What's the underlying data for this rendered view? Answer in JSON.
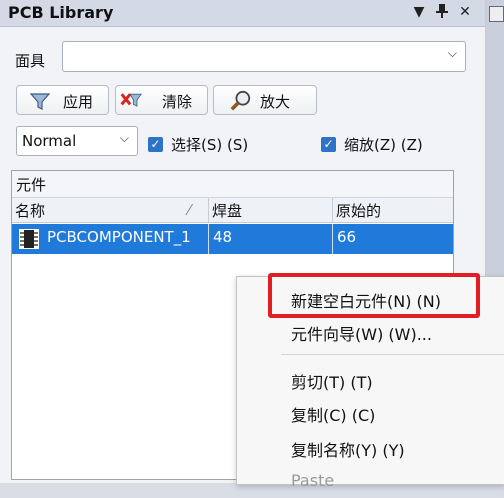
{
  "panel": {
    "title": "PCB Library",
    "title_buttons": [
      "▼",
      "📌",
      "✕"
    ]
  },
  "filter": {
    "label": "面具",
    "value": ""
  },
  "toolbar": {
    "apply_label": "应用",
    "clear_label": "清除",
    "zoom_label": "放大"
  },
  "options": {
    "mode_value": "Normal",
    "select_label": "选择(S) (S)",
    "select_checked": true,
    "zoom_label": "缩放(Z) (Z)",
    "zoom_checked": true
  },
  "list": {
    "group_title": "元件",
    "columns": [
      "名称",
      "焊盘",
      "原始的"
    ],
    "rows": [
      {
        "name": "PCBCOMPONENT_1",
        "pads": "48",
        "primitives": "66"
      }
    ]
  },
  "context_menu": {
    "items": [
      {
        "label": "新建空白元件(N) (N)"
      },
      {
        "label": "元件向导(W) (W)..."
      },
      {
        "label": "剪切(T) (T)"
      },
      {
        "label": "复制(C) (C)"
      },
      {
        "label": "复制名称(Y) (Y)"
      },
      {
        "label": "Paste"
      }
    ]
  },
  "colors": {
    "selection": "#1f7ad9",
    "highlight_box": "#e01e24",
    "checkbox": "#2d73c7"
  }
}
